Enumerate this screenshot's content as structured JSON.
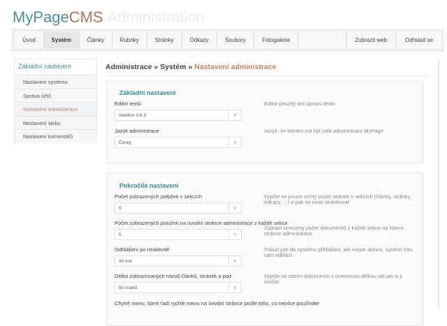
{
  "header": {
    "brand_a": "MyPage",
    "brand_b": "CMS",
    "brand_c": "Administration"
  },
  "nav": [
    {
      "label": "Úvod"
    },
    {
      "label": "Systém"
    },
    {
      "label": "Články"
    },
    {
      "label": "Rubriky"
    },
    {
      "label": "Stránky"
    },
    {
      "label": "Odkazy"
    },
    {
      "label": "Soubory"
    },
    {
      "label": "Fotogalerie"
    },
    {
      "label": ""
    },
    {
      "label": "Zobrazit web"
    },
    {
      "label": "Odhlásit se"
    }
  ],
  "sidebar": {
    "heading": "Základní nastavení",
    "items": [
      {
        "label": "Nastavení systému"
      },
      {
        "label": "Správa účtů"
      },
      {
        "label": "Nastavení administrace"
      },
      {
        "label": "Nastavení webu"
      },
      {
        "label": "Nastavení komentářů"
      }
    ]
  },
  "breadcrumb": {
    "a": "Administrace",
    "b": "Systém",
    "current": "Nastavení administrace",
    "sep": " » "
  },
  "basic": {
    "title": "Základní nastavení",
    "fields": [
      {
        "label": "Editor textů",
        "value": "ckeditor 3.6.3",
        "desc": "Editor použitý pro úpravu textu"
      },
      {
        "label": "Jazyk administrace",
        "value": "Česky",
        "desc": "Jazyk, ve kterém má být celá administrace MyPage"
      }
    ]
  },
  "advanced": {
    "title": "Pokročilé nastavení",
    "fields": [
      {
        "label": "Počet zobrazených položek v sekcích",
        "value": "5",
        "desc": "Vypíše se pouze určitý počet stránek v sekcích (články, stránky, odkazy, ...) a pak se musí stránkovat"
      },
      {
        "label": "Počet zobrazených položek na úvodní stránce administrace z každé sekce",
        "value": "5",
        "desc": "Zobrazí omezený počet dokumentů z každé sekce na hlavní stránce administrace"
      },
      {
        "label": "Odhlášení po neaktivitě",
        "value": "30 min",
        "desc": "Pokud jste do systému přihlášeni, ale nejste aktivní, systém Vás sám odhlásí"
      },
      {
        "label": "Délka zobrazovaných názvů článků, stránek a pod",
        "value": "50 znaků",
        "desc": "Vypíše se název dokumentu s omezenou délkou tak jak si ji zvolíte"
      }
    ],
    "last_label": "Chytré menu, které řadí rychlé menu na úvodní stránce podle toho, co nejvíce používáte"
  }
}
